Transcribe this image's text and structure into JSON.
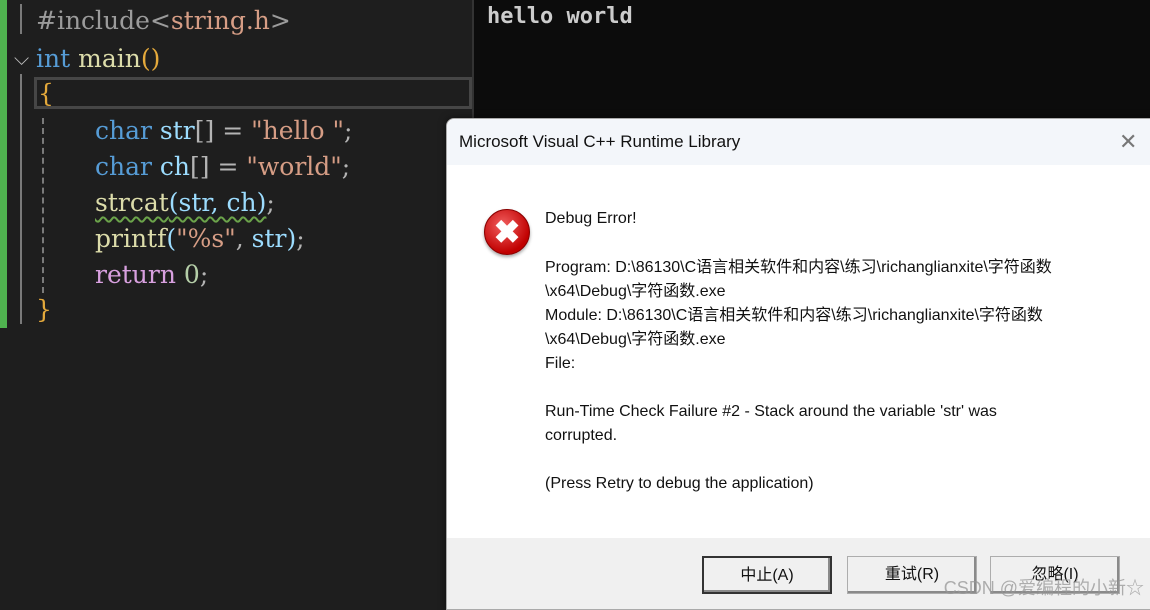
{
  "editor": {
    "lines": {
      "l1": {
        "hash": "#include",
        "lt": "<",
        "file": "string.h",
        "gt": ">"
      },
      "l2": {
        "kw": "int",
        "fn": "main",
        "paren": "()"
      },
      "l3": {
        "brace": "{"
      },
      "l4": {
        "kw": "char",
        "var": "str",
        "rest": "[] = ",
        "str": "\"hello \"",
        "semi": ";"
      },
      "l5": {
        "kw": "char",
        "var": "ch",
        "rest": "[] = ",
        "str": "\"world\"",
        "semi": ";"
      },
      "l6": {
        "fn": "strcat",
        "args": "(str, ch)",
        "semi": ";"
      },
      "l7": {
        "fn": "printf",
        "open": "(",
        "str": "\"%s\"",
        "rest": ", ",
        "var": "str",
        "close": ")",
        "semi": ";"
      },
      "l8": {
        "kw": "return",
        "num": "0",
        "semi": ";"
      },
      "l9": {
        "brace": "}"
      }
    }
  },
  "console": {
    "output": "hello world"
  },
  "dialog": {
    "title": "Microsoft Visual C++ Runtime Library",
    "heading": "Debug Error!",
    "program": "Program: D:\\86130\\C语言相关软件和内容\\练习\\richanglianxite\\字符函数",
    "program2": "\\x64\\Debug\\字符函数.exe",
    "module": "Module: D:\\86130\\C语言相关软件和内容\\练习\\richanglianxite\\字符函数",
    "module2": "\\x64\\Debug\\字符函数.exe",
    "file": "File:",
    "failure": "Run-Time Check Failure #2 - Stack around the variable 'str' was",
    "failure2": "corrupted.",
    "hint": "(Press Retry to debug the application)",
    "buttons": {
      "abort": "中止(A)",
      "retry": "重试(R)",
      "ignore": "忽略(I)"
    },
    "close_glyph": "✕",
    "icon_glyph": "✖"
  },
  "watermark": "CSDN @爱编程的小新☆"
}
